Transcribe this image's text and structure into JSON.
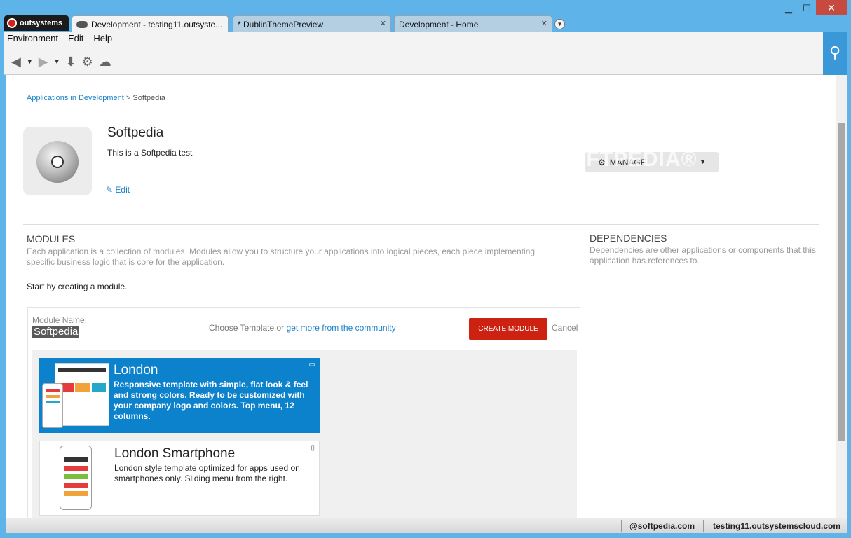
{
  "window": {
    "minimize": "▁",
    "maximize": "☐",
    "close": "✕"
  },
  "logo": {
    "text": "outsystems"
  },
  "tabs": [
    {
      "label": "Development - testing11.outsyste...",
      "active": true
    },
    {
      "label": "* DublinThemePreview",
      "active": false
    },
    {
      "label": "Development - Home",
      "active": false
    }
  ],
  "menu": [
    "Environment",
    "Edit",
    "Help"
  ],
  "toolbar": {
    "back_icon": "◀",
    "forward_icon": "▶",
    "caret": "▼",
    "download_icon": "⬇",
    "settings_icon": "⚙",
    "cloud_icon": "☁",
    "search_icon": "⚲"
  },
  "breadcrumb": {
    "link": "Applications in Development",
    "separator": ">",
    "current": "Softpedia"
  },
  "app": {
    "name": "Softpedia",
    "description": "This is a Softpedia test",
    "edit_label": "Edit",
    "edit_icon": "✎"
  },
  "manage": {
    "label": "MANAGE",
    "icon": "⚙",
    "caret": "▼"
  },
  "watermark": "SOFTPEDIA®",
  "modules": {
    "title": "MODULES",
    "desc_line1": "Each application is a collection of modules. Modules allow you to structure your applications into logical pieces, each piece implementing",
    "desc_line2": "specific business logic that is core for the application.",
    "start_text": "Start by creating a module."
  },
  "dependencies": {
    "title": "DEPENDENCIES",
    "desc_line1": "Dependencies are other applications or components that this",
    "desc_line2": "application has references to."
  },
  "create_panel": {
    "module_name_label": "Module Name:",
    "module_name_value": "Softpedia",
    "choose_text": "Choose Template or",
    "community_link": "get more from the community",
    "create_button": "CREATE MODULE",
    "cancel": "Cancel"
  },
  "templates": [
    {
      "name": "London",
      "description": "Responsive template with simple, flat look & feel and strong colors. Ready to be customized with your company logo and colors. Top menu, 12 columns.",
      "badge_icon": "desktop-icon",
      "badge": "▭",
      "selected": true
    },
    {
      "name": "London Smartphone",
      "description": "London style template optimized for apps used on smartphones only. Sliding menu from the right.",
      "badge_icon": "smartphone-icon",
      "badge": "▯",
      "selected": false
    }
  ],
  "status_bar": {
    "user": "@softpedia.com",
    "server": "testing11.outsystemscloud.com"
  },
  "colors": {
    "accent": "#1a83c5",
    "create_button": "#cd2112",
    "selected_card": "#0c82cc",
    "frame": "#5eb4e8"
  }
}
